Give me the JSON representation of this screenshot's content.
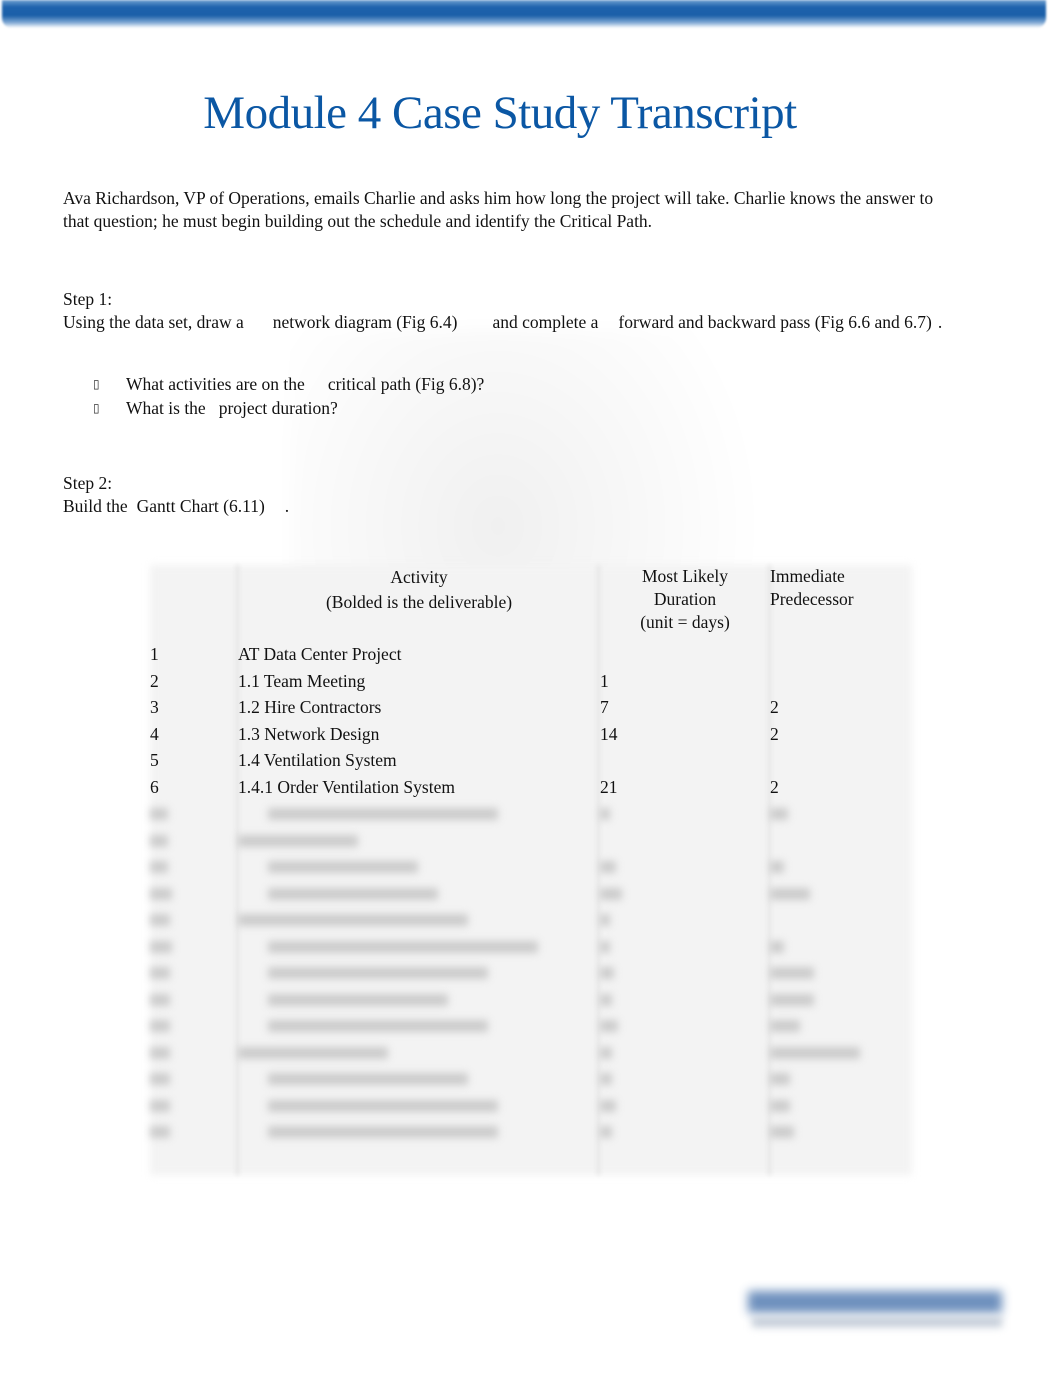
{
  "document": {
    "title": "Module 4 Case Study Transcript",
    "intro": "Ava Richardson, VP of Operations, emails Charlie and asks him how long the project will take. Charlie knows the answer to that question; he must begin building out the schedule and identify the Critical Path.",
    "step1": {
      "label": "Step 1:",
      "text_a": "Using the data set, draw a",
      "text_b": "network diagram (Fig 6.4)",
      "text_c": "and complete a",
      "text_d": "forward and backward pass (Fig 6.6 and 6.7)",
      "text_e": ".",
      "bullet_icon": "missing-glyph-box",
      "bullets": [
        {
          "a": "What activities are on the",
          "b": "critical path (Fig 6.8)?"
        },
        {
          "a": "What is the",
          "b": "project duration?"
        }
      ]
    },
    "step2": {
      "label": "Step 2:",
      "text_a": "Build the",
      "text_b": "Gantt Chart (6.11)",
      "text_c": "."
    },
    "table": {
      "headers": {
        "activity_line1": "Activity",
        "activity_line2": "(Bolded is the deliverable)",
        "duration_line1": "Most Likely",
        "duration_line2": "Duration",
        "duration_line3": "(unit = days)",
        "predecessor_line1": "Immediate",
        "predecessor_line2": "Predecessor"
      },
      "rows": [
        {
          "num": "1",
          "activity": "AT Data Center Project",
          "duration": "",
          "predecessor": ""
        },
        {
          "num": "2",
          "activity": "1.1 Team Meeting",
          "duration": "1",
          "predecessor": ""
        },
        {
          "num": "3",
          "activity": "1.2 Hire Contractors",
          "duration": "7",
          "predecessor": "2"
        },
        {
          "num": "4",
          "activity": "1.3 Network Design",
          "duration": "14",
          "predecessor": "2"
        },
        {
          "num": "5",
          "activity": "1.4 Ventilation System",
          "duration": "",
          "predecessor": ""
        },
        {
          "num": "6",
          "activity": "1.4.1 Order Ventilation System",
          "duration": "21",
          "predecessor": "2"
        }
      ],
      "blurred_row_count": 14
    }
  }
}
